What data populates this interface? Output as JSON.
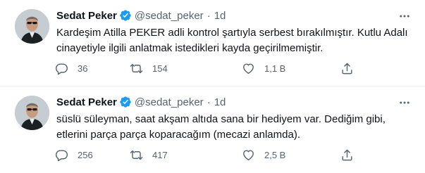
{
  "icons": {
    "verified": "verified-badge-icon",
    "more": "more-icon",
    "reply": "reply-icon",
    "retweet": "retweet-icon",
    "like": "like-icon",
    "share": "share-icon"
  },
  "colors": {
    "accent": "#1d9bf0",
    "text": "#0f1419",
    "secondary": "#536471",
    "divider": "#eff3f4"
  },
  "tweets": [
    {
      "author": "Sedat Peker",
      "handle": "@sedat_peker",
      "separator": "·",
      "time": "1d",
      "text_line1": "Kardeşim Atilla PEKER adli kontrol şartıyla serbest bırakılmıştır. Kutlu Adalı",
      "text_line2": "cinayetiyle ilgili anlatmak istedikleri kayda geçirilmemiştir.",
      "replies": "36",
      "retweets": "154",
      "likes": "1,1 B"
    },
    {
      "author": "Sedat Peker",
      "handle": "@sedat_peker",
      "separator": "·",
      "time": "1d",
      "text_line1": "süslü süleyman, saat akşam altıda sana bir hediyem var. Dediğim gibi,",
      "text_line2": "etlerini parça parça koparacağım (mecazi anlamda).",
      "replies": "256",
      "retweets": "417",
      "likes": "2,5 B"
    }
  ]
}
